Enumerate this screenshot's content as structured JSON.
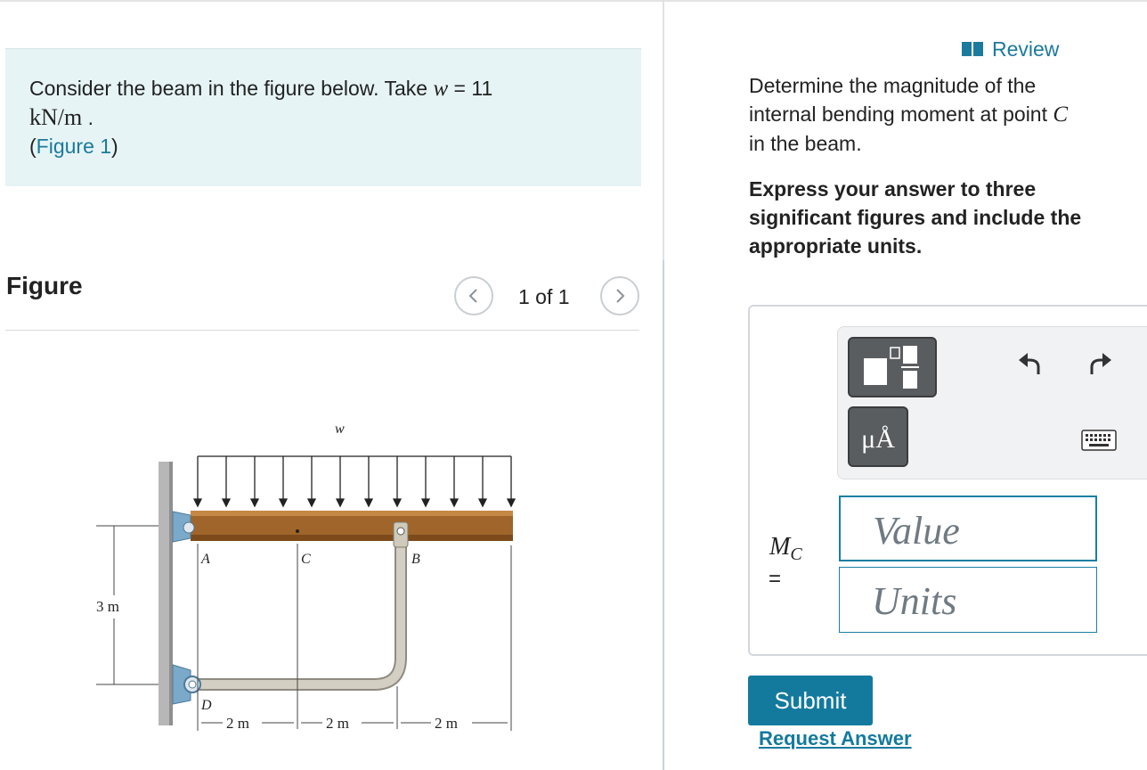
{
  "problem": {
    "text_before": "Consider the beam in the figure below. Take",
    "var": "w",
    "equals": "= 11",
    "units": "kN/m",
    "units_after": ".",
    "figure_link": "Figure 1",
    "paren_open": "(",
    "paren_close": ")"
  },
  "figure": {
    "heading": "Figure",
    "pager_text": "1 of 1",
    "prev_icon": "chevron-left-icon",
    "next_icon": "chevron-right-icon",
    "labels": {
      "w": "w",
      "A": "A",
      "B": "B",
      "C": "C",
      "D": "D",
      "height": "3 m",
      "seg1": "2 m",
      "seg2": "2 m",
      "seg3": "2 m"
    },
    "colors": {
      "beam": "#a0652a",
      "pipe": "#c9c4b6",
      "support": "#7aa9c9",
      "wall": "#b7b7b7"
    }
  },
  "header": {
    "review_label": "Review",
    "review_icon": "book-icon"
  },
  "question": {
    "line1": "Determine the magnitude of the internal bending moment at point",
    "point": "C",
    "line2": "in the beam.",
    "instruction": "Express your answer to three significant figures and include the appropriate units."
  },
  "answer": {
    "label_main": "M",
    "label_sub": "C",
    "equals": "=",
    "value_placeholder": "Value",
    "units_placeholder": "Units",
    "units_button": "μÅ",
    "templates_icon": "fraction-template-icon",
    "undo_icon": "undo-icon",
    "redo_icon": "redo-icon",
    "keyboard_icon": "keyboard-icon"
  },
  "actions": {
    "submit": "Submit",
    "request": "Request Answer"
  },
  "colors": {
    "accent": "#137a9e",
    "problem_bg": "#e6f4f5"
  }
}
